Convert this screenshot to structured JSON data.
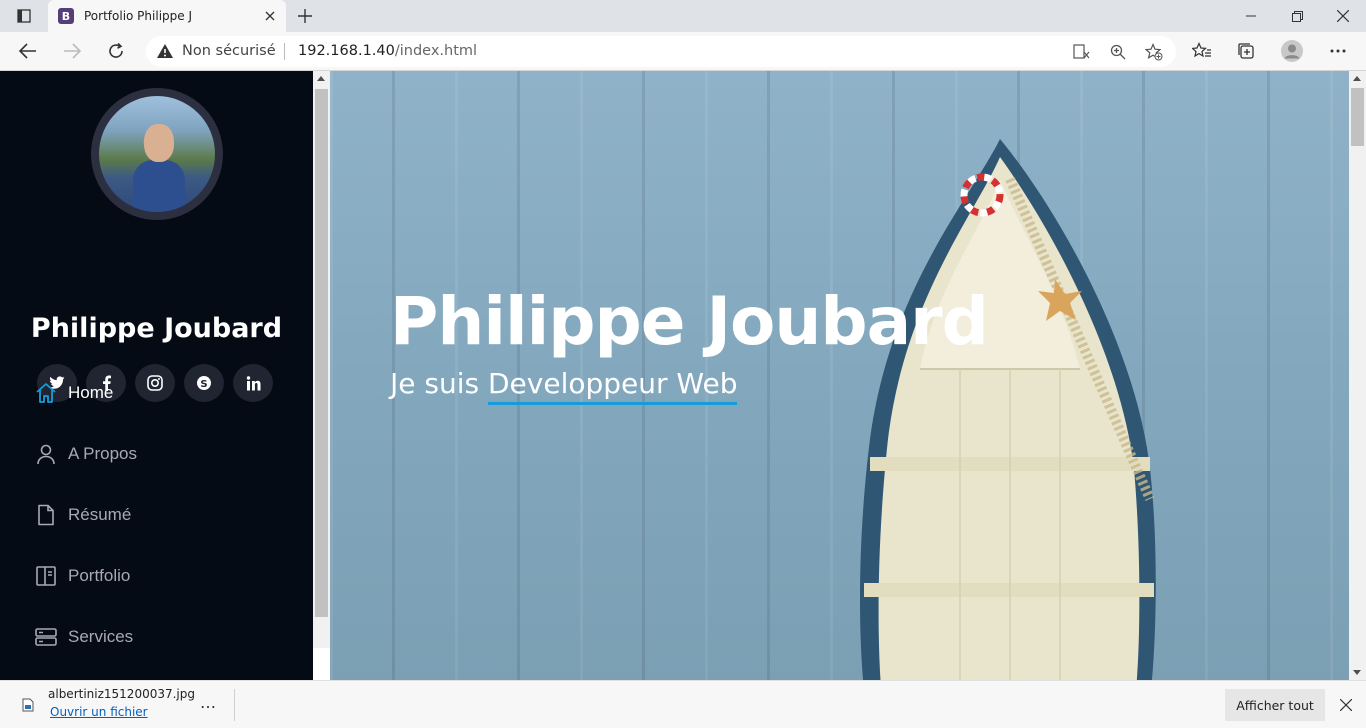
{
  "browser": {
    "tab_title": "Portfolio Philippe J",
    "tab_favicon_letter": "B",
    "security_label": "Non sécurisé",
    "url_host": "192.168.1.40",
    "url_path": "/index.html"
  },
  "sidebar": {
    "name": "Philippe Joubard",
    "socials": [
      {
        "icon": "twitter-icon",
        "glyph": "t"
      },
      {
        "icon": "facebook-icon",
        "glyph": "f"
      },
      {
        "icon": "instagram-icon",
        "glyph": "◎"
      },
      {
        "icon": "skype-icon",
        "glyph": "S"
      },
      {
        "icon": "linkedin-icon",
        "glyph": "in"
      }
    ],
    "menu": [
      {
        "label": "Home",
        "icon": "home-icon",
        "active": true
      },
      {
        "label": "A Propos",
        "icon": "person-icon",
        "active": false
      },
      {
        "label": "Résumé",
        "icon": "file-icon",
        "active": false
      },
      {
        "label": "Portfolio",
        "icon": "book-icon",
        "active": false
      },
      {
        "label": "Services",
        "icon": "server-icon",
        "active": false
      }
    ]
  },
  "hero": {
    "title": "Philippe Joubard",
    "subtitle_prefix": "Je suis ",
    "subtitle_typed": "Developpeur Web"
  },
  "download": {
    "filename": "albertiniz151200037.jpg",
    "open_label": "Ouvrir un fichier",
    "more_label": "…",
    "show_all_label": "Afficher tout"
  },
  "colors": {
    "sidebar_bg": "#040b14",
    "accent": "#149ddd",
    "social_bg": "#212431",
    "menu_text": "#a8a9b4"
  }
}
